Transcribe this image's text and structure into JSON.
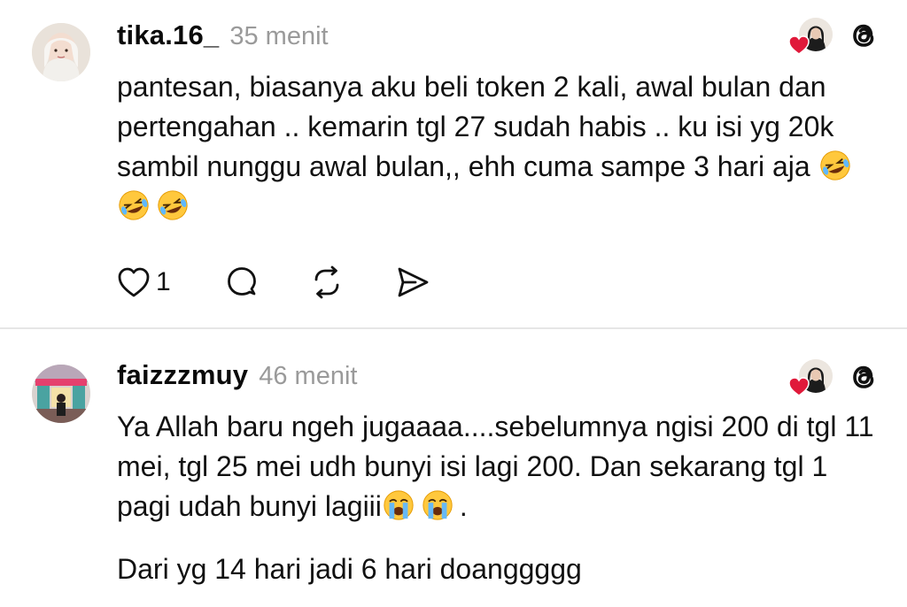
{
  "posts": [
    {
      "username": "tika.16_",
      "time": "35 menit",
      "paragraphs": [
        "pantesan, biasanya aku beli token 2 kali, awal bulan dan pertengahan .. kemarin tgl 27 sudah habis .. ku isi yg 20k sambil nunggu awal bulan,, ehh cuma sampe 3 hari aja"
      ],
      "emoji_icons": [
        "rofl-emoji-icon",
        "rofl-emoji-icon",
        "rofl-emoji-icon"
      ],
      "like_count": "1"
    },
    {
      "username": "faizzzmuy",
      "time": "46 menit",
      "paragraphs": [
        "Ya Allah baru ngeh jugaaaa....sebelumnya ngisi 200 di tgl 11 mei, tgl 25 mei udh bunyi isi lagi 200. Dan sekarang tgl 1 pagi udah bunyi lagiii",
        "Dari yg 14 hari jadi 6 hari doanggggg"
      ],
      "emoji_icons": [
        "loudly-crying-emoji-icon",
        "loudly-crying-emoji-icon"
      ],
      "trailing_text": "."
    }
  ],
  "icons": {
    "like": "heart-outline-icon",
    "reply": "comment-bubble-icon",
    "repost": "repost-icon",
    "share": "send-icon",
    "liked_by": "red-heart-icon",
    "app": "threads-logo-icon"
  },
  "colors": {
    "text": "#111111",
    "muted": "#9a9a9a",
    "heart": "#e0193a",
    "separator": "#e6e6e6"
  }
}
